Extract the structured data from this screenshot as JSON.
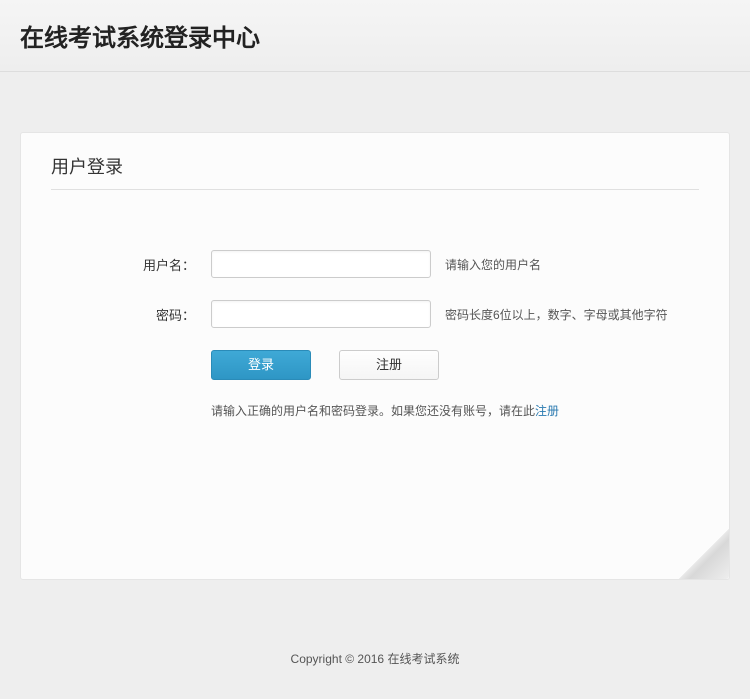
{
  "header": {
    "title": "在线考试系统登录中心"
  },
  "panel": {
    "title": "用户登录"
  },
  "form": {
    "username": {
      "label": "用户名：",
      "hint": "请输入您的用户名"
    },
    "password": {
      "label": "密码：",
      "hint": "密码长度6位以上，数字、字母或其他字符"
    }
  },
  "buttons": {
    "login": "登录",
    "register": "注册"
  },
  "help": {
    "prefix": "请输入正确的用户名和密码登录。如果您还没有账号，请在此",
    "link": "注册"
  },
  "footer": {
    "text": "Copyright © 2016 在线考试系统"
  }
}
